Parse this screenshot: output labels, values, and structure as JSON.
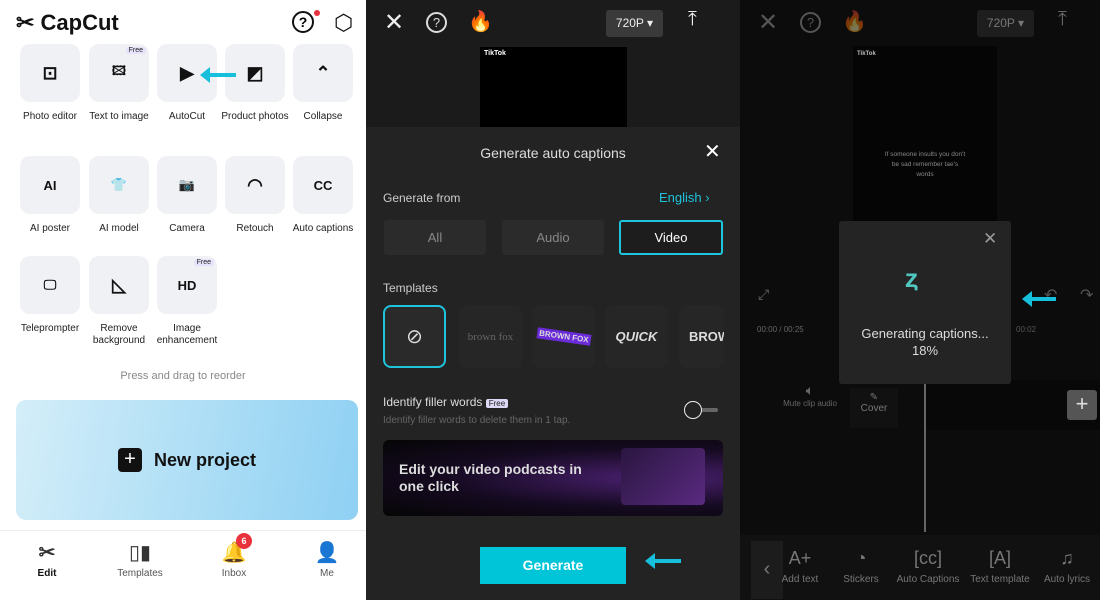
{
  "home": {
    "logo": "CapCut",
    "tools": [
      {
        "label": "Photo editor",
        "icon": "photo-editor-icon",
        "glyph": "⊡"
      },
      {
        "label": "Text to image",
        "icon": "text-to-image-icon",
        "glyph": "🖾",
        "badge": "Free"
      },
      {
        "label": "AutoCut",
        "icon": "autocut-icon",
        "glyph": "▶"
      },
      {
        "label": "Product photos",
        "icon": "product-photos-icon",
        "glyph": "◩"
      },
      {
        "label": "Collapse",
        "icon": "chevron-up-icon",
        "glyph": "⌃"
      },
      {
        "label": "AI poster",
        "icon": "ai-poster-icon",
        "glyph": "AI"
      },
      {
        "label": "AI model",
        "icon": "ai-model-icon",
        "glyph": "👕"
      },
      {
        "label": "Camera",
        "icon": "camera-icon",
        "glyph": "📷"
      },
      {
        "label": "Retouch",
        "icon": "retouch-icon",
        "glyph": "◠"
      },
      {
        "label": "Auto captions",
        "icon": "auto-captions-icon",
        "glyph": "CC"
      },
      {
        "label": "Teleprompter",
        "icon": "teleprompter-icon",
        "glyph": "🖵"
      },
      {
        "label": "Remove background",
        "icon": "remove-background-icon",
        "glyph": "◺"
      },
      {
        "label": "Image enhancement",
        "icon": "image-enhancement-icon",
        "glyph": "HD",
        "badge": "Free"
      }
    ],
    "hint": "Press and drag to reorder",
    "new_project": "New project",
    "nav": [
      {
        "label": "Edit",
        "icon": "scissors-icon",
        "glyph": "✂"
      },
      {
        "label": "Templates",
        "icon": "templates-icon",
        "glyph": "▯▮"
      },
      {
        "label": "Inbox",
        "icon": "bell-icon",
        "glyph": "🔔",
        "badge": "6"
      },
      {
        "label": "Me",
        "icon": "user-icon",
        "glyph": "👤"
      }
    ]
  },
  "captions_sheet": {
    "resolution": "720P",
    "title": "Generate auto captions",
    "generate_from_label": "Generate from",
    "language": "English",
    "sources": [
      "All",
      "Audio",
      "Video"
    ],
    "selected_source": "Video",
    "templates_label": "Templates",
    "templates": [
      "brown fox",
      "BROWN FOX",
      "QUICK",
      "BROW"
    ],
    "filler_label": "Identify filler words",
    "filler_badge": "Free",
    "filler_desc": "Identify filler words to delete them in 1 tap.",
    "filler_enabled": false,
    "banner": "Edit your video podcasts in one click",
    "generate_button": "Generate",
    "tiktok_watermark": "TikTok"
  },
  "progress": {
    "resolution": "720P",
    "video_text": "If someone insults you don't be sad remember tae's words",
    "tiktok_watermark": "TikTok",
    "status": "Generating captions...",
    "percent_label": "18%",
    "percent": 18,
    "time_current": "00:00",
    "time_total": "00:25",
    "time_marker": "00:02",
    "mute_label": "Mute clip audio",
    "cover_label": "Cover",
    "tools": [
      {
        "label": "Add text",
        "icon": "add-text-icon",
        "glyph": "A+"
      },
      {
        "label": "Stickers",
        "icon": "stickers-icon",
        "glyph": "◔"
      },
      {
        "label": "Auto Captions",
        "icon": "auto-captions-icon",
        "glyph": "[cc]"
      },
      {
        "label": "Text template",
        "icon": "text-template-icon",
        "glyph": "[A]"
      },
      {
        "label": "Auto lyrics",
        "icon": "auto-lyrics-icon",
        "glyph": "♫"
      }
    ]
  },
  "colors": {
    "accent": "#16c0dc",
    "notification": "#e8323c"
  }
}
